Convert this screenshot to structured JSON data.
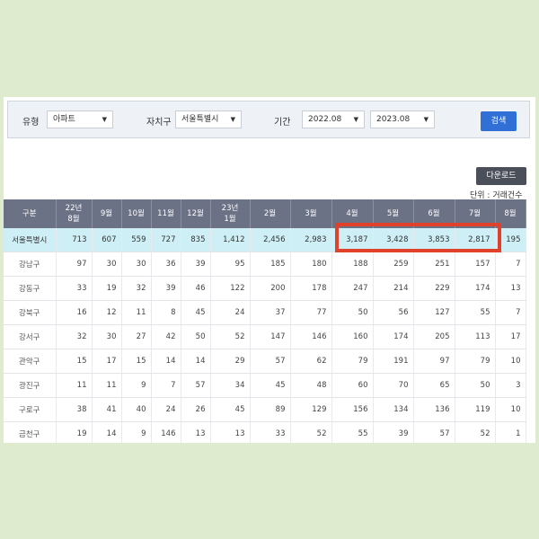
{
  "filters": {
    "type_label": "유형",
    "type_value": "아파트",
    "district_label": "자치구",
    "district_value": "서울특별시",
    "period_label": "기간",
    "period_start": "2022.08",
    "period_end": "2023.08",
    "search_label": "검색"
  },
  "download_label": "다운로드",
  "unit_note": "단위 : 거래건수",
  "table": {
    "headers": [
      "구분",
      "22년\n8월",
      "9월",
      "10월",
      "11월",
      "12월",
      "23년\n1월",
      "2월",
      "3월",
      "4월",
      "5월",
      "6월",
      "7월",
      "8월"
    ],
    "rows": [
      {
        "name": "서울특별시",
        "values": [
          "713",
          "607",
          "559",
          "727",
          "835",
          "1,412",
          "2,456",
          "2,983",
          "3,187",
          "3,428",
          "3,853",
          "2,817",
          "195"
        ]
      },
      {
        "name": "강남구",
        "values": [
          "97",
          "30",
          "30",
          "36",
          "39",
          "95",
          "185",
          "180",
          "188",
          "259",
          "251",
          "157",
          "7"
        ]
      },
      {
        "name": "강동구",
        "values": [
          "33",
          "19",
          "32",
          "39",
          "46",
          "122",
          "200",
          "178",
          "247",
          "214",
          "229",
          "174",
          "13"
        ]
      },
      {
        "name": "강북구",
        "values": [
          "16",
          "12",
          "11",
          "8",
          "45",
          "24",
          "37",
          "77",
          "50",
          "56",
          "127",
          "55",
          "7"
        ]
      },
      {
        "name": "강서구",
        "values": [
          "32",
          "30",
          "27",
          "42",
          "50",
          "52",
          "147",
          "146",
          "160",
          "174",
          "205",
          "113",
          "17"
        ]
      },
      {
        "name": "관악구",
        "values": [
          "15",
          "17",
          "15",
          "14",
          "14",
          "29",
          "57",
          "62",
          "79",
          "191",
          "97",
          "79",
          "10"
        ]
      },
      {
        "name": "광진구",
        "values": [
          "11",
          "11",
          "9",
          "7",
          "57",
          "34",
          "45",
          "48",
          "60",
          "70",
          "65",
          "50",
          "3"
        ]
      },
      {
        "name": "구로구",
        "values": [
          "38",
          "41",
          "40",
          "24",
          "26",
          "45",
          "89",
          "129",
          "156",
          "134",
          "136",
          "119",
          "10"
        ]
      },
      {
        "name": "금천구",
        "values": [
          "19",
          "14",
          "9",
          "146",
          "13",
          "13",
          "33",
          "52",
          "55",
          "39",
          "57",
          "52",
          "1"
        ]
      }
    ]
  },
  "colors": {
    "header_bg": "#6b7285",
    "total_row_bg": "#cfeff6",
    "highlight": "#e0412a",
    "search_button": "#2f6fd6"
  }
}
